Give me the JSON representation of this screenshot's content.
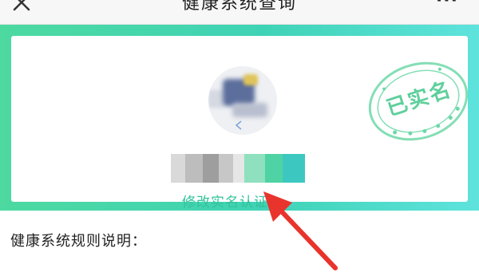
{
  "header": {
    "title": "健康系统查询",
    "more_label": "···"
  },
  "card": {
    "stamp_text": "已实名",
    "modify_link_label": "修改实名认证",
    "modify_link_arrow": ">"
  },
  "rules": {
    "title": "健康系统规则说明："
  },
  "colors": {
    "accent_green": "#33c29a",
    "banner_start": "#4dd9a0",
    "banner_end": "#5ee3dd",
    "annotation_red": "#e8342c"
  },
  "icons": {
    "back": "close-icon",
    "more": "more-icon",
    "link_arrow": "chevron-right-icon",
    "annotation": "red-arrow-icon"
  }
}
